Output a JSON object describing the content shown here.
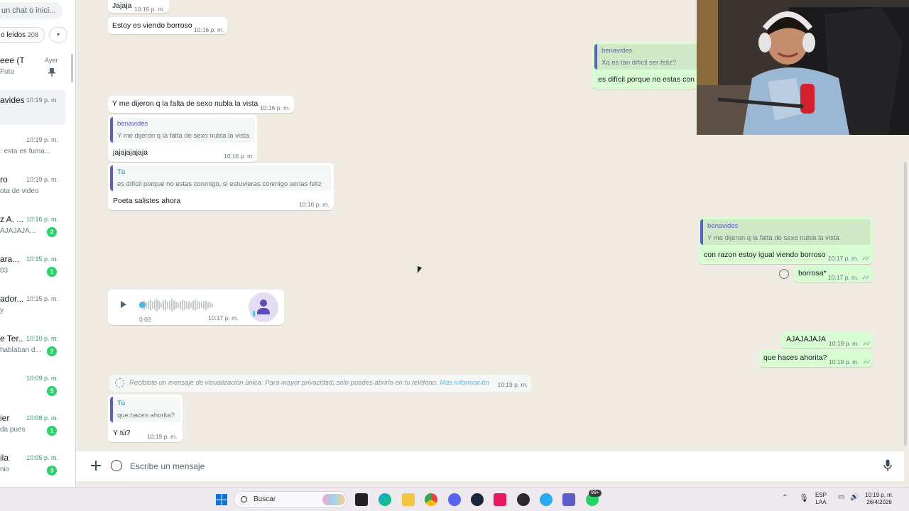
{
  "sidebar": {
    "search_placeholder": "un chat o inici...",
    "filter_label": "o leídos",
    "filter_count": "208",
    "chats": [
      {
        "name": "eee (Tú)",
        "time": "Ayer",
        "preview": "Foto",
        "badge": "",
        "pinned": true,
        "time_green": false
      },
      {
        "name": "avides",
        "time": "10:19 p. m.",
        "preview": "",
        "badge": "",
        "pinned": false,
        "time_green": false
      },
      {
        "name": "",
        "time": "10:19 p. m.",
        "preview": ": esta es fuma...",
        "badge": "",
        "pinned": false,
        "time_green": false
      },
      {
        "name": "ro",
        "time": "10:19 p. m.",
        "preview": "ota de video",
        "badge": "",
        "pinned": false,
        "time_green": false
      },
      {
        "name": "z A. ...",
        "time": "10:16 p. m.",
        "preview": "AJAJAJA...",
        "badge": "2",
        "pinned": false,
        "time_green": true
      },
      {
        "name": "ara...",
        "time": "10:15 p. m.",
        "preview": "03",
        "badge": "1",
        "pinned": false,
        "time_green": true
      },
      {
        "name": "ador...",
        "time": "10:15 p. m.",
        "preview": "y",
        "badge": "",
        "pinned": false,
        "time_green": false
      },
      {
        "name": "e Ter...",
        "time": "10:10 p. m.",
        "preview": "hablaban d...",
        "badge": "2",
        "pinned": false,
        "time_green": true
      },
      {
        "name": "",
        "time": "10:09 p. m.",
        "preview": "",
        "badge": "5",
        "pinned": false,
        "time_green": true
      },
      {
        "name": "ier",
        "time": "10:08 p. m.",
        "preview": "da pues",
        "badge": "1",
        "pinned": false,
        "time_green": true
      },
      {
        "name": "ila",
        "time": "10:05 p. m.",
        "preview": "nio",
        "badge": "3",
        "pinned": false,
        "time_green": true
      }
    ]
  },
  "messages": {
    "m1": {
      "text": "Jajaja",
      "time": "10:15 p. m."
    },
    "m2": {
      "text": "Estoy es viendo borroso",
      "time": "10:16 p. m."
    },
    "m3": {
      "quote_author": "benavides",
      "quote_text": "Xq es tan difícil ser feliz?",
      "text": "es difícil porque no estas con"
    },
    "m4": {
      "text": "Y me dijeron q la falta de sexo nubla la vista",
      "time": "10:16 p. m."
    },
    "m5": {
      "quote_author": "benavides",
      "quote_text": "Y me dijeron q la falta de sexo nubla la vista",
      "text": "jajajajajaja",
      "time": "10:16 p. m."
    },
    "m6": {
      "quote_author": "Tú",
      "quote_text": "es difícil porque no estas conmigo, si estuvieras conmigo serias feliz",
      "text": "Poeta salistes ahora",
      "time": "10:16 p. m."
    },
    "m7": {
      "quote_author": "benavides",
      "quote_text": "Y me dijeron q la falta de sexo nubla la vista",
      "text": "con razon estoy igual viendo borroso",
      "time": "10:17 p. m."
    },
    "m8": {
      "text": "borrosa*",
      "time": "10:17 p. m."
    },
    "voice": {
      "duration": "0:02",
      "time": "10:17 p. m."
    },
    "m9": {
      "text": "AJAJAJAJA",
      "time": "10:19 p. m."
    },
    "m10": {
      "text": "que haces ahorita?",
      "time": "10:19 p. m."
    },
    "system": {
      "text": "Recibiste un mensaje de visualización única. Para mayor privacidad, solo puedes abrirlo en tu teléfono.",
      "link": "Más información",
      "time": "10:19 p. m."
    },
    "m11": {
      "quote_author": "Tú",
      "quote_text": "que haces ahorita?",
      "text": "Y tú?",
      "time": "10:19 p. m."
    }
  },
  "composer": {
    "placeholder": "Escribe un mensaje"
  },
  "taskbar": {
    "search_label": "Buscar",
    "whatsapp_badge": "99+",
    "lang_top": "ESP",
    "lang_bottom": "LAA",
    "clock_time": "10:19 p. m.",
    "clock_date": "26/4/2026"
  },
  "colors": {
    "accent": "#25d366",
    "outgoing": "#d9fdd3",
    "chat_bg": "#efeae2",
    "quote_author": "#5b5fc7"
  }
}
